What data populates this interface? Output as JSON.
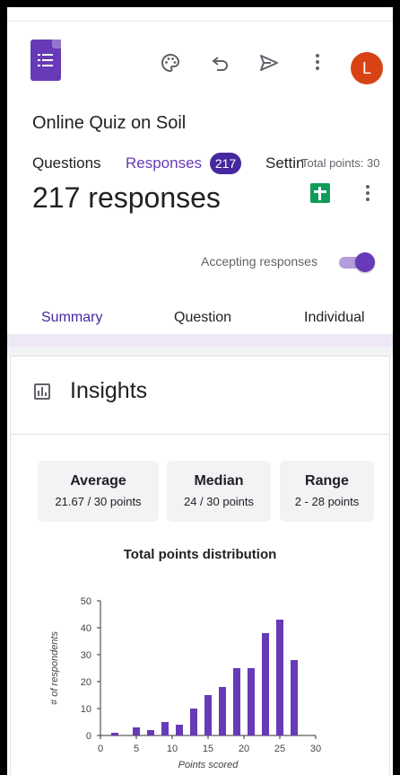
{
  "header": {
    "form_title": "Online Quiz on Soil",
    "avatar_letter": "L",
    "tabs": [
      {
        "label": "Questions"
      },
      {
        "label": "Responses",
        "badge": "217"
      },
      {
        "label": "Settings"
      }
    ],
    "total_points": "Total points: 30"
  },
  "responses": {
    "count_text": "217 responses",
    "accepting_label": "Accepting responses",
    "accepting": true,
    "subtabs": [
      {
        "label": "Summary"
      },
      {
        "label": "Question"
      },
      {
        "label": "Individual"
      }
    ]
  },
  "insights": {
    "title": "Insights",
    "stats": [
      {
        "label": "Average",
        "value": "21.67 / 30 points"
      },
      {
        "label": "Median",
        "value": "24 / 30 points"
      },
      {
        "label": "Range",
        "value": "2 - 28 points"
      }
    ]
  },
  "colors": {
    "accent": "#673ab7",
    "bar": "#673ab7",
    "badge": "#4527a0",
    "avatar": "#d84315",
    "sheets": "#0f9d58"
  },
  "icons": [
    "forms-logo-icon",
    "palette-icon",
    "undo-icon",
    "send-icon",
    "more-vert-icon",
    "sheets-icon",
    "insights-chart-icon"
  ],
  "chart_data": {
    "type": "bar",
    "title": "Total points distribution",
    "xlabel": "Points scored",
    "ylabel": "# of respondents",
    "x": [
      2,
      5,
      7,
      9,
      11,
      13,
      15,
      17,
      19,
      21,
      23,
      25,
      27
    ],
    "values": [
      1,
      3,
      2,
      5,
      4,
      10,
      15,
      18,
      25,
      25,
      38,
      43,
      28
    ],
    "xlim": [
      0,
      30
    ],
    "ylim": [
      0,
      50
    ],
    "xticks": [
      0,
      5,
      10,
      15,
      20,
      25,
      30
    ],
    "yticks": [
      0,
      10,
      20,
      30,
      40,
      50
    ],
    "grid": false
  }
}
